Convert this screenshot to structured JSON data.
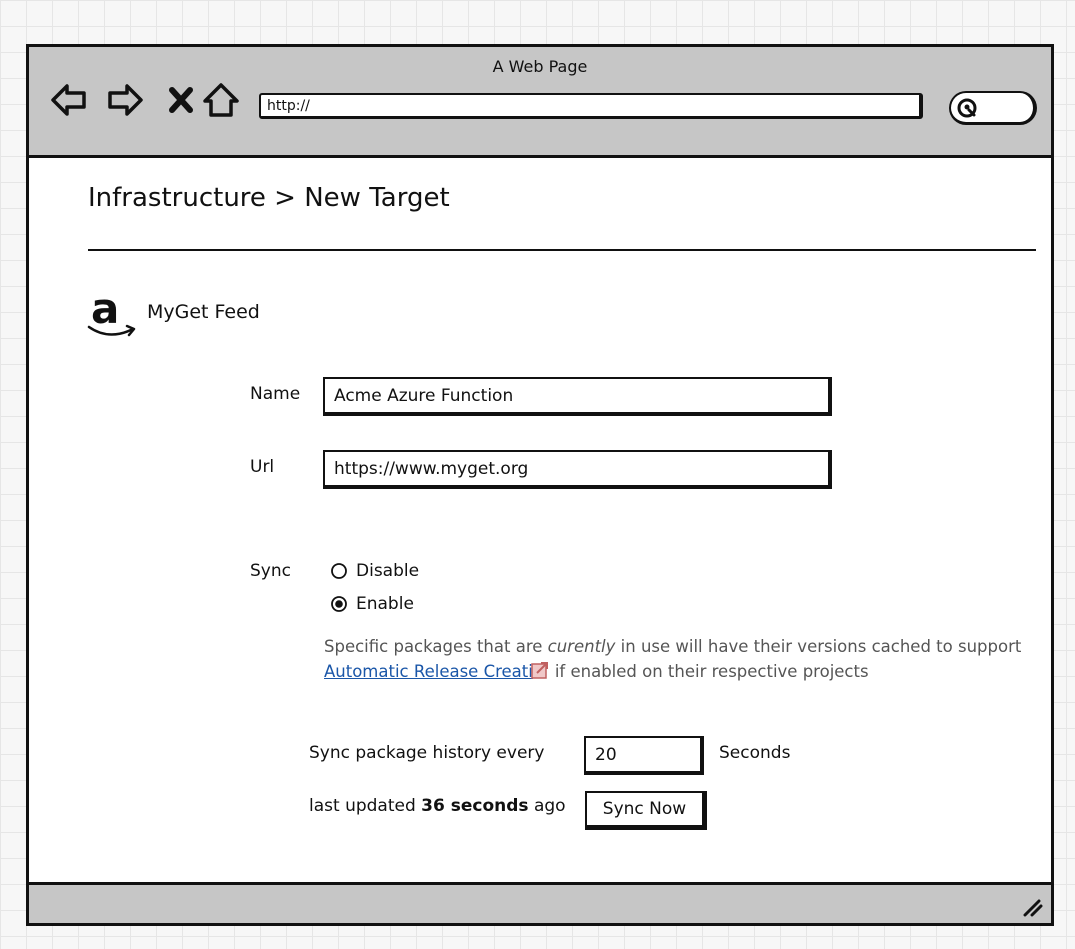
{
  "browser": {
    "window_title": "A Web Page",
    "url": "http://",
    "nav_icons": [
      "back-icon",
      "forward-icon",
      "stop-icon",
      "home-icon"
    ],
    "search_icon": "search-icon"
  },
  "page": {
    "breadcrumb": "Infrastructure > New Target",
    "provider": {
      "logo": "amazon-logo",
      "name": "MyGet Feed"
    }
  },
  "form": {
    "name_label": "Name",
    "name_value": "Acme Azure Function",
    "url_label": "Url",
    "url_value": "https://www.myget.org",
    "sync_label": "Sync",
    "sync_options": [
      {
        "label": "Disable",
        "selected": false
      },
      {
        "label": "Enable",
        "selected": true
      }
    ],
    "help_text_1": "Specific packages that are ",
    "help_text_emphasis": "curently",
    "help_text_2": " in use will have their versions cached to support ",
    "help_link": "Automatic Release Creati",
    "help_text_3": "if enabled on their respective projects",
    "interval_label": "Sync package history every",
    "interval_value": "20",
    "interval_unit": "Seconds",
    "last_updated_prefix": "last updated ",
    "last_updated_value": "36 seconds",
    "last_updated_suffix": " ago",
    "sync_now_label": "Sync Now"
  }
}
